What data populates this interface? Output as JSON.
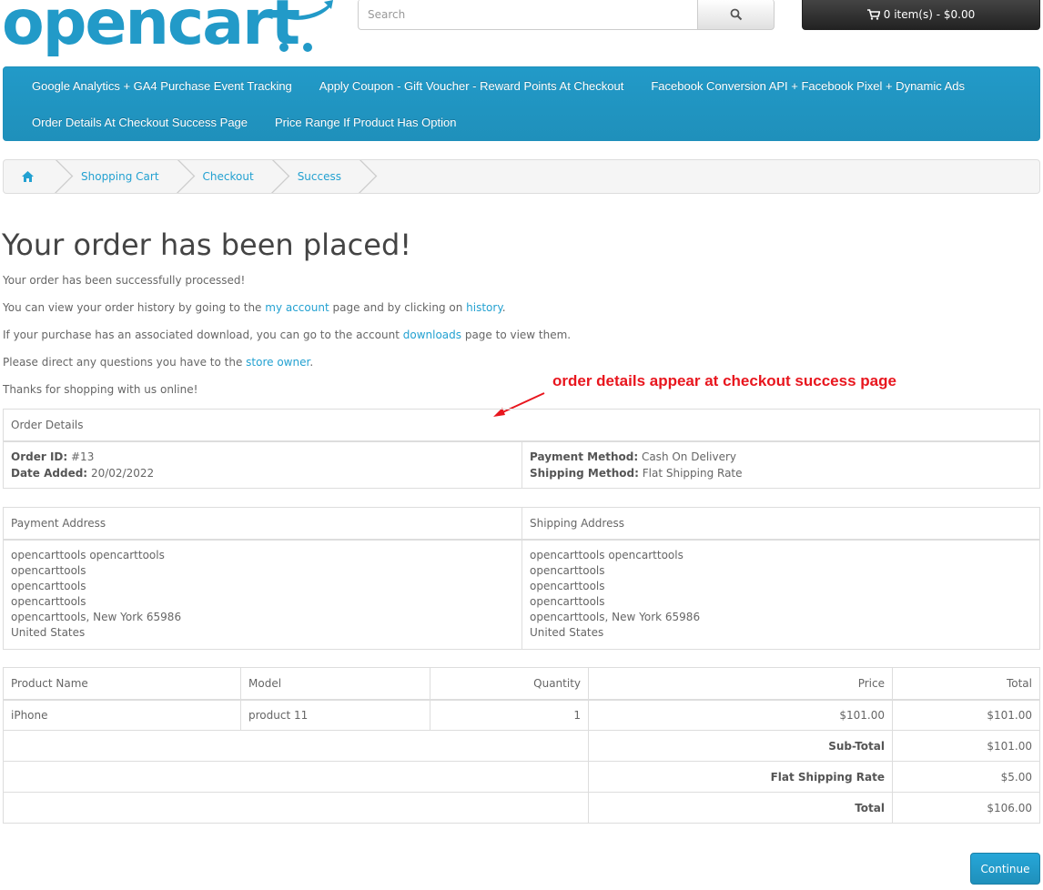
{
  "header": {
    "logo_text": "opencart",
    "search_placeholder": "Search",
    "cart_label": "0 item(s) - $0.00",
    "colors": {
      "brand": "#229ac8",
      "link": "#23a1d1",
      "annotation": "#e8161e"
    }
  },
  "menu": {
    "items": [
      "Google Analytics + GA4 Purchase Event Tracking",
      "Apply Coupon - Gift Voucher - Reward Points At Checkout",
      "Facebook Conversion API + Facebook Pixel + Dynamic Ads",
      "Order Details At Checkout Success Page",
      "Price Range If Product Has Option"
    ]
  },
  "breadcrumb": {
    "home_icon": "home-icon",
    "items": [
      "Shopping Cart",
      "Checkout",
      "Success"
    ]
  },
  "page": {
    "title": "Your order has been placed!",
    "p1": "Your order has been successfully processed!",
    "p2_a": "You can view your order history by going to the ",
    "p2_link1": "my account",
    "p2_b": " page and by clicking on ",
    "p2_link2": "history",
    "p2_c": ".",
    "p3_a": "If your purchase has an associated download, you can go to the account ",
    "p3_link": "downloads",
    "p3_b": " page to view them.",
    "p4_a": "Please direct any questions you have to the ",
    "p4_link": "store owner",
    "p4_b": ".",
    "p5": "Thanks for shopping with us online!",
    "annotation": "order details appear at checkout success page"
  },
  "order_details": {
    "heading": "Order Details",
    "order_id_label": "Order ID:",
    "order_id": "#13",
    "date_added_label": "Date Added:",
    "date_added": "20/02/2022",
    "payment_method_label": "Payment Method:",
    "payment_method": "Cash On Delivery",
    "shipping_method_label": "Shipping Method:",
    "shipping_method": "Flat Shipping Rate"
  },
  "addresses": {
    "payment_heading": "Payment Address",
    "shipping_heading": "Shipping Address",
    "payment_lines": [
      "opencarttools opencarttools",
      "opencarttools",
      "opencarttools",
      "opencarttools",
      "opencarttools, New York 65986",
      "United States"
    ],
    "shipping_lines": [
      "opencarttools opencarttools",
      "opencarttools",
      "opencarttools",
      "opencarttools",
      "opencarttools, New York 65986",
      "United States"
    ]
  },
  "products": {
    "headers": {
      "name": "Product Name",
      "model": "Model",
      "quantity": "Quantity",
      "price": "Price",
      "total": "Total"
    },
    "rows": [
      {
        "name": "iPhone",
        "model": "product 11",
        "quantity": "1",
        "price": "$101.00",
        "total": "$101.00"
      }
    ],
    "totals": [
      {
        "label": "Sub-Total",
        "value": "$101.00"
      },
      {
        "label": "Flat Shipping Rate",
        "value": "$5.00"
      },
      {
        "label": "Total",
        "value": "$106.00"
      }
    ]
  },
  "continue_label": "Continue"
}
